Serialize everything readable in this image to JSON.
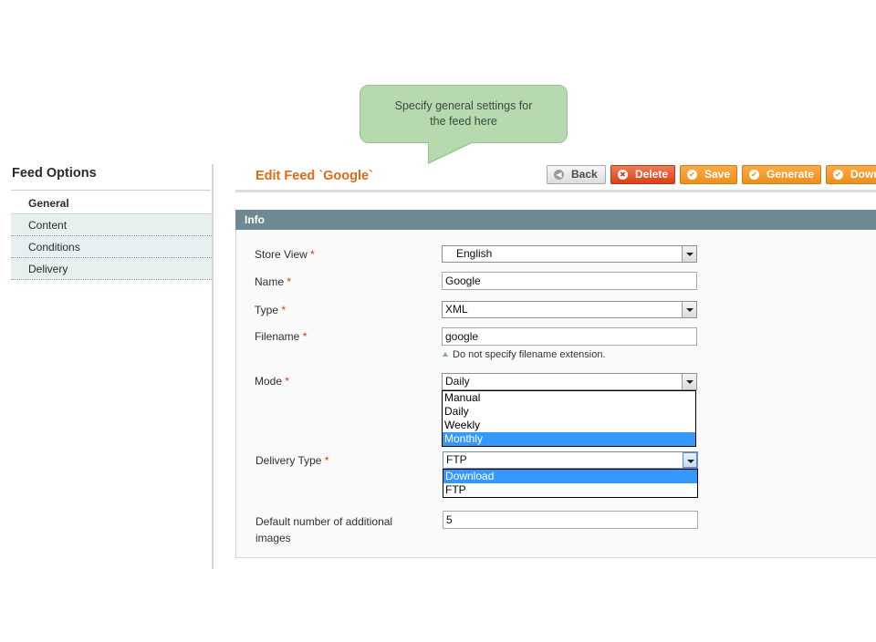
{
  "tooltip": {
    "text": "Specify general settings for the feed here"
  },
  "sidebar": {
    "title": "Feed Options",
    "tabs": [
      {
        "label": "General",
        "active": true
      },
      {
        "label": "Content",
        "active": false
      },
      {
        "label": "Conditions",
        "active": false
      },
      {
        "label": "Delivery",
        "active": false
      }
    ]
  },
  "header": {
    "title": "Edit Feed `Google`",
    "buttons": {
      "back": "Back",
      "delete": "Delete",
      "save": "Save",
      "generate": "Generate",
      "download": "Down"
    }
  },
  "fieldset": {
    "title": "Info",
    "required_mark": "*",
    "store_view": {
      "label": "Store View",
      "value": "English"
    },
    "name": {
      "label": "Name",
      "value": "Google"
    },
    "type": {
      "label": "Type",
      "value": "XML"
    },
    "filename": {
      "label": "Filename",
      "value": "google",
      "note": "Do not specify filename extension."
    },
    "mode": {
      "label": "Mode",
      "value": "Daily",
      "options": [
        "Manual",
        "Daily",
        "Weekly",
        "Monthly"
      ],
      "highlighted": "Monthly"
    },
    "delivery_type": {
      "label": "Delivery Type",
      "value": "FTP",
      "options": [
        "Download",
        "FTP"
      ],
      "highlighted": "Download"
    },
    "additional_images": {
      "label_line1": "Default number of additional",
      "label_line2": "images",
      "value": "5"
    }
  },
  "colors": {
    "accent_title": "#e06a16",
    "section_header": "#6f8992",
    "button_orange": "#ec8f1e",
    "button_delete": "#d94017",
    "tooltip_green": "#b6d9b0",
    "highlight_blue": "#3399ff"
  }
}
